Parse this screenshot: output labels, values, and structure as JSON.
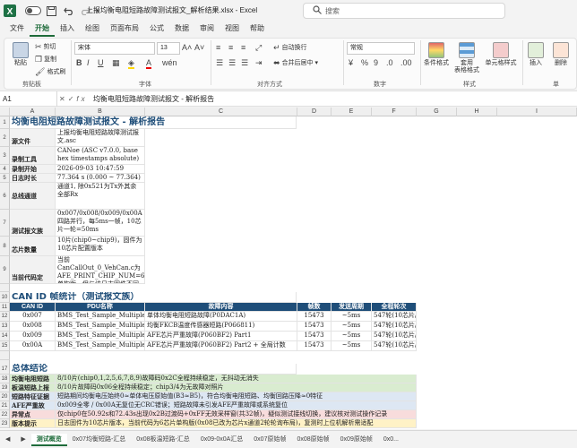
{
  "titlebar": {
    "autosave": "自动保存",
    "title": "上报均衡电阻短路故障测试报文_解析结果.xlsx  -  Excel",
    "search_placeholder": "搜索"
  },
  "tabs": [
    "文件",
    "开始",
    "插入",
    "绘图",
    "页面布局",
    "公式",
    "数据",
    "审阅",
    "视图",
    "帮助"
  ],
  "active_tab": "开始",
  "ribbon": {
    "paste": "粘贴",
    "cut": "剪切",
    "copy": "复制",
    "format_painter": "格式刷",
    "font_name": "宋体",
    "font_size": "13",
    "wrap_text": "自动换行",
    "merge_center": "合并后居中",
    "number_format": "常规",
    "cond_format": "条件格式",
    "table_format": "套用\n表格格式",
    "cell_style": "单元格样式",
    "insert": "插入",
    "delete": "删除",
    "groups": {
      "clipboard": "剪贴板",
      "font": "字体",
      "alignment": "对齐方式",
      "number": "数字",
      "styles": "样式",
      "cells": "单"
    }
  },
  "formula_bar": {
    "name_box": "A1",
    "fx": "fx",
    "content": "均衡电阻短路故障测试报文 - 解析报告"
  },
  "columns": [
    "A",
    "B",
    "C",
    "D",
    "E",
    "F",
    "G",
    "H",
    "I"
  ],
  "sheet": {
    "title": "均衡电阻短路故障测试报文 - 解析报告",
    "info": [
      {
        "row": "2",
        "label": "源文件",
        "value": "上报均衡电阻短路故障测试报文.asc"
      },
      {
        "row": "3",
        "label": "录制工具",
        "value": "CANoe (ASC v7.0.0, base hex timestamps absolute)"
      },
      {
        "row": "4",
        "label": "录制开始",
        "value": "2026-09-03 10:47:59"
      },
      {
        "row": "5",
        "label": "日志时长",
        "value": "77.364 s (0.000 ~ 77.364)"
      },
      {
        "row": "6",
        "label": "总线通道",
        "value": "通道1, 除0x521为Tx外其余全部Rx"
      },
      {
        "row": "7",
        "label": "测试报文族",
        "value": "0x007/0x008/0x009/0x00A 四路并行，每5ms一帧，10芯片一轮=50ms"
      },
      {
        "row": "8",
        "label": "芯片数量",
        "value": "10片(chip0~chip9)，固件为10芯片配置版本"
      },
      {
        "row": "9",
        "label": "当前代码定",
        "value": "当前CanCallOut_0_VehCan.c为AFE_PRINT_CHIP_NUM=6单构版，但与该日志固件不同"
      }
    ],
    "section2": "CAN ID 帧统计（测试报文族）",
    "table_headers": [
      "CAN ID",
      "PDU名称",
      "故障内容",
      "帧数",
      "发送周期",
      "全程轮次"
    ],
    "table_rows": [
      {
        "row": "12",
        "id": "0x007",
        "pdu": "BMS_Test_Sample_Multiple07",
        "fault": "单体均衡电阻短路故障(P0DAC1A)",
        "count": "15473",
        "period": "~5ms",
        "rounds": "547轮(10芯片/轮)"
      },
      {
        "row": "13",
        "id": "0x008",
        "pdu": "BMS_Test_Sample_Multiple08",
        "fault": "均衡FKCB温度传感器短路(P066811)",
        "count": "15473",
        "period": "~5ms",
        "rounds": "547轮(10芯片/轮)"
      },
      {
        "row": "14",
        "id": "0x009",
        "pdu": "BMS_Test_Sample_Multiple09",
        "fault": "AFE芯片严重故障(P060BF2) Part1",
        "count": "15473",
        "period": "~5ms",
        "rounds": "547轮(10芯片/轮)"
      },
      {
        "row": "15",
        "id": "0x00A",
        "pdu": "BMS_Test_Sample_Multiple0A",
        "fault": "AFE芯片严重故障(P060BF2) Part2 + 全局计数",
        "count": "15473",
        "period": "~5ms",
        "rounds": "547轮(10芯片/轮)"
      }
    ],
    "section3": "总体结论",
    "conclusions": [
      {
        "row": "18",
        "label": "均衡电阻短路",
        "value": "8/10片(chip0,1,2,5,6,7,8,9)故障码0x2C全程持续稳定，无抖动无消失",
        "color": "green"
      },
      {
        "row": "19",
        "label": "板温短路上报",
        "value": "8/10片故障码0x06全程持续稳定；chip3/4为无故障对照片",
        "color": "green"
      },
      {
        "row": "20",
        "label": "短路特征证据",
        "value": "短路期间均衡电压始终0≈单体电压原始值(B3≈B5)，符合均衡电阻短路、均衡回路压降≈0特征",
        "color": "blue"
      },
      {
        "row": "21",
        "label": "AFE严重故",
        "value": "0x009全零 / 0x00A无复位无CRC错误；短路故障未引发AFE严重故障或系统复位",
        "color": "blue"
      },
      {
        "row": "22",
        "label": "异常点",
        "value": "仅chip0在50.92s和72.43s出现0x2B过渡码+0xFF无效采样窗(共32帧)，疑似测试接线切换，建议核对测试操作记录",
        "color": "red"
      },
      {
        "row": "23",
        "label": "版本提示",
        "value": "日志固件为10芯片版本，当前代码为6芯片单构版(0x08已改为芯片x通道2轮轮询布局)，复测时上位机解析需适配",
        "color": "yellow"
      }
    ]
  },
  "sheet_tabs": [
    "测试概览",
    "0x07均衡短路-汇总",
    "0x08板温短路-汇总",
    "0x09-0x0A汇总",
    "0x07原始帧",
    "0x08原始帧",
    "0x09原始帧",
    "0x0..."
  ],
  "active_sheet": "测试概览"
}
